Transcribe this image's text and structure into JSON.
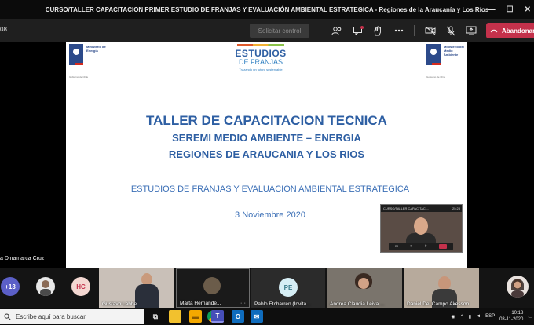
{
  "window": {
    "title": "CURSO/TALLER CAPACITACION PRIMER ESTUDIO DE FRANJAS Y EVALUACIÓN AMBIENTAL ESTRATEGICA - Regiones de la Araucanía y Los Ríos",
    "minimize": "—",
    "maximize": "☐",
    "close": "✕"
  },
  "toolbar": {
    "timer": "08",
    "request_control": "Solicitar control",
    "leave_label": "Abandonar"
  },
  "slide": {
    "left_ministry": "Ministerio de Energía",
    "left_bottom": "Gobierno de Chile",
    "right_ministry": "Ministerio del Medio Ambiente",
    "right_bottom": "Gobierno de Chile",
    "logo_line1": "ESTUDIOS",
    "logo_line2": "DE FRANJAS",
    "logo_tagline": "Trazando un futuro sustentable",
    "title": "TALLER DE CAPACITACION TECNICA",
    "subtitle1": "SEREMI MEDIO AMBIENTE – ENERGIA",
    "subtitle2": "REGIONES DE ARAUCANIA Y LOS RIOS",
    "line4": "ESTUDIOS DE FRANJAS Y EVALUACION AMBIENTAL ESTRATEGICA",
    "date": "3 Noviembre 2020"
  },
  "presenter_name": "a Dinamarca Cruz",
  "mini_window": {
    "title": "CURSO/TALLER CAPACITACI...",
    "timer": "25:28"
  },
  "participants": {
    "overflow": "+13",
    "initials_hc": "HC",
    "tiles": [
      {
        "name": "Gustavo Labbe"
      },
      {
        "name": "Marta Hernande..."
      },
      {
        "name": "Pablo Etcharren (Invita..."
      },
      {
        "name": "Andrea Claudia Leiva ..."
      },
      {
        "name": "Daniel Del Campo Akesson"
      }
    ],
    "initials_pe": "PE"
  },
  "taskbar": {
    "search_placeholder": "Escribe aquí para buscar",
    "lang": "ESP",
    "time": "10:18",
    "date": "03-11-2020"
  }
}
